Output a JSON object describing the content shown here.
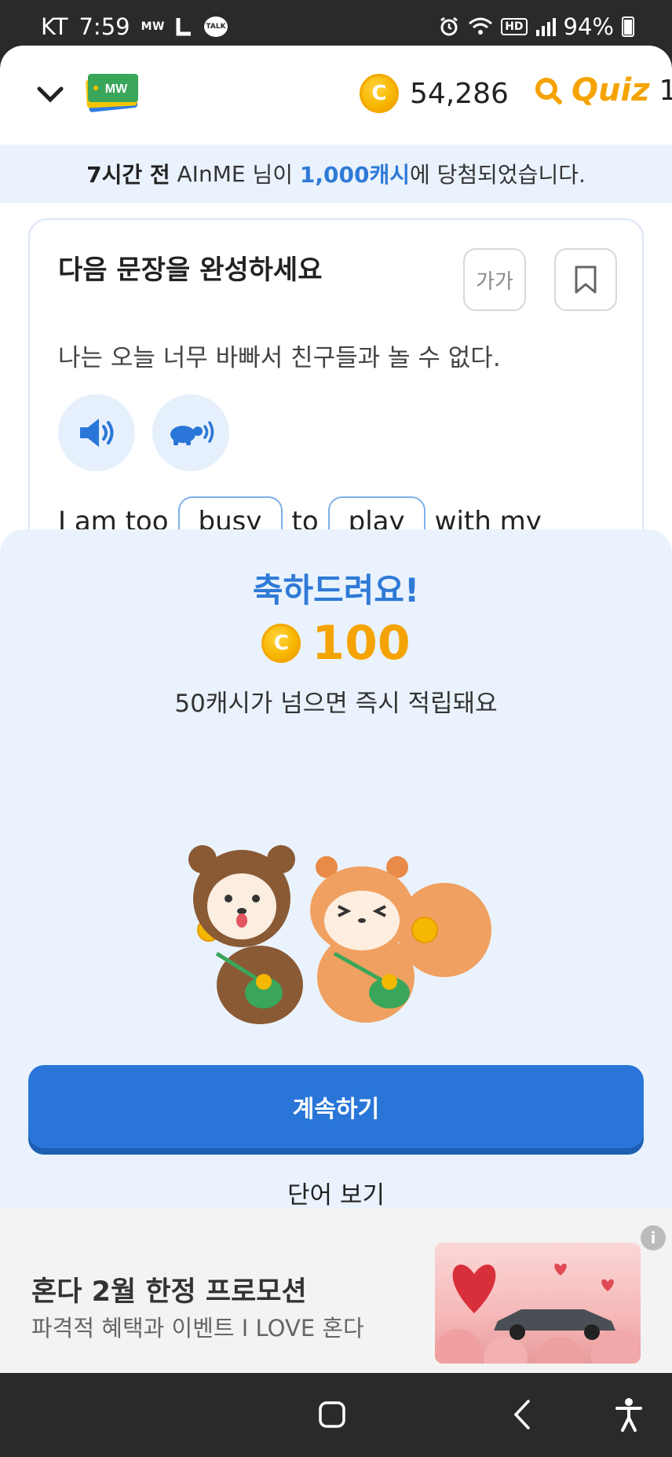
{
  "status_bar": {
    "carrier": "KT",
    "time": "7:59",
    "app_tag": "MW",
    "talk_badge": "TALK",
    "hd_label": "HD",
    "battery": "94%"
  },
  "header": {
    "logo_text": "MW",
    "coin_symbol": "C",
    "coin_balance": "54,286",
    "quiz_label": "Quiz",
    "quiz_count": "1"
  },
  "notice": {
    "time_ago": "7시간 전",
    "user_name": "AInME",
    "suffix_user": "님이",
    "amount": "1,000캐시",
    "suffix_end": "에 당첨되었습니다."
  },
  "question": {
    "title": "다음 문장을 완성하세요",
    "font_size_button": "가가",
    "sentence": "나는 오늘 너무 바빠서 친구들과 놀 수 없다.",
    "answer_parts": [
      "I am too",
      "busy",
      "to",
      "play",
      "with my"
    ]
  },
  "popup": {
    "congrats": "축하드려요!",
    "reward_symbol": "C",
    "reward_amount": "100",
    "note": "50캐시가 넘으면 즉시 적립돼요",
    "continue_label": "계속하기",
    "word_link": "단어 보기"
  },
  "ad": {
    "title": "혼다 2월 한정 프로모션",
    "subtitle": "파격적 혜택과 이벤트 I LOVE 혼다",
    "info_icon": "i"
  },
  "colors": {
    "accent_blue": "#2a76d8",
    "coin_gold": "#f5a300",
    "sheet_bg": "#eaf3fd"
  }
}
